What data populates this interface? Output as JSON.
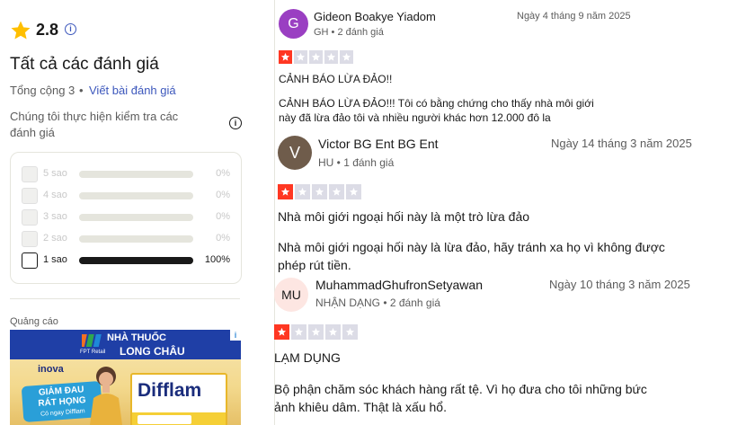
{
  "summary": {
    "rating": "2.8",
    "info_glyph": "i",
    "all_reviews_title": "Tất cả các đánh giá",
    "total": "Tổng cộng 3",
    "separator": "•",
    "write_review": "Viết bài đánh giá",
    "check_text": "Chúng tôi thực hiện kiểm tra các đánh giá",
    "info_glyph2": "i"
  },
  "distribution": [
    {
      "label": "5 sao",
      "percent": "0%",
      "fraction": 0
    },
    {
      "label": "4 sao",
      "percent": "0%",
      "fraction": 0
    },
    {
      "label": "3 sao",
      "percent": "0%",
      "fraction": 0
    },
    {
      "label": "2 sao",
      "percent": "0%",
      "fraction": 0
    },
    {
      "label": "1 sao",
      "percent": "100%",
      "fraction": 1
    }
  ],
  "ad": {
    "label": "Quảng cáo",
    "pharmacy_line1": "NHÀ THUỐC",
    "pharmacy_line2": "LONG CHÂU",
    "fpt": "FPT Retail",
    "info": "i",
    "inova": "inova",
    "giam_line1": "GIẢM ĐAU",
    "giam_line2": "RÁT HỌNG",
    "giam_sub": "Có ngay Difflam",
    "product": "Difflam"
  },
  "colors": {
    "star_red": "#ff3722",
    "star_gray": "#dcdce6",
    "link": "#3c57bc",
    "avatar_g": "#9a3fc2",
    "avatar_v": "#6f5c4b",
    "avatar_mu": "#fde6e2"
  },
  "reviews": [
    {
      "avatar": "G",
      "name": "Gideon Boakye Yiadom",
      "sub": "GH • 2 đánh giá",
      "date": "Ngày 4 tháng 9 năm 2025",
      "stars": 1,
      "title": "CẢNH BÁO LỪA ĐẢO!!",
      "text_line1": "CẢNH BÁO LỪA ĐẢO!!! Tôi có bằng chứng cho thấy nhà môi giới",
      "text_line2": "này đã lừa đảo tôi và nhiều người khác hơn 12.000 đô la"
    },
    {
      "avatar": "V",
      "name": "Victor BG Ent BG Ent",
      "sub": "HU • 1 đánh giá",
      "date": "Ngày 14 tháng 3 năm 2025",
      "stars": 1,
      "title": "Nhà môi giới ngoại hối này là một trò lừa đảo",
      "text_line1": "Nhà môi giới ngoại hối này là lừa đảo, hãy tránh xa họ vì không được",
      "text_line2": "phép rút tiền."
    },
    {
      "avatar": "MU",
      "name": "MuhammadGhufronSetyawan",
      "sub": "NHẬN DẠNG • 2 đánh giá",
      "date": "Ngày 10 tháng 3 năm 2025",
      "stars": 1,
      "title": "LẠM DỤNG",
      "text_line1": "Bộ phận chăm sóc khách hàng rất tệ. Vì họ đưa cho tôi những bức",
      "text_line2": "ảnh khiêu dâm. Thật là xấu hổ."
    }
  ]
}
